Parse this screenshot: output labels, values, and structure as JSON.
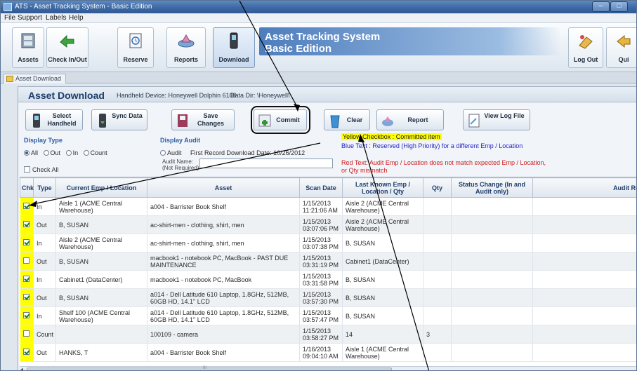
{
  "window": {
    "title": "ATS - Asset Tracking System - Basic Edition",
    "min": "–",
    "max": "□"
  },
  "menu": [
    "File",
    "Support",
    "Labels",
    "Help"
  ],
  "ribbon": {
    "buttons": [
      {
        "label": "Assets"
      },
      {
        "label": "Check In/Out"
      },
      {
        "label": "Reserve"
      },
      {
        "label": "Reports"
      },
      {
        "label": "Download"
      }
    ],
    "app_title_1": "Asset Tracking System",
    "app_title_2": "Basic Edition",
    "log_out": "Log Out",
    "quit": "Qui"
  },
  "doc_tab": "Asset Download",
  "panel": {
    "title": "Asset Download",
    "device": "Handheld Device:  Honeywell Dolphin 6100",
    "data_dir": "Data Dir: \\Honeywell\\"
  },
  "actions": {
    "select": "Select Handheld",
    "sync": "Sync Data",
    "save": "Save Changes",
    "commit": "Commit",
    "clear": "Clear",
    "report": "Report",
    "viewlog": "View Log File"
  },
  "display_type": {
    "label": "Display Type",
    "options": [
      "All",
      "Out",
      "In",
      "Count"
    ],
    "selected": "All"
  },
  "display_audit": {
    "label": "Display Audit",
    "audit_option": "Audit",
    "first_record": "First Record Download Date:   10/26/2012",
    "audit_name_label": "Audit Name:",
    "audit_name_hint": "(Not Required)",
    "audit_name_value": ""
  },
  "legend": {
    "yellow": "Yellow Checkbox :  Committed item",
    "blue": "Blue Text :  Reserved (High Priority) for a different Emp / Location",
    "red": "Red Text:  Audit Emp / Location does not match expected Emp / Location, or Qty mismatch"
  },
  "check_all": "Check All",
  "columns": [
    "Chk",
    "Type",
    "Current Emp / Location",
    "Asset",
    "Scan Date",
    "Last Known Emp / Location / Qty",
    "Qty",
    "Status Change (In and Audit only)",
    "Audit Result"
  ],
  "rows": [
    {
      "chk": true,
      "committed": true,
      "type": "In",
      "emp": "Aisle 1 (ACME Central Warehouse)",
      "asset": "a004 - Barrister Book Shelf",
      "scan": "1/15/2013 11:21:06 AM",
      "last": "Aisle 2 (ACME Central Warehouse)",
      "qty": "",
      "status": "",
      "result": "",
      "style": ""
    },
    {
      "chk": true,
      "committed": true,
      "type": "Out",
      "emp": "B, SUSAN",
      "asset": "ac-shirt-men - clothing, shirt, men",
      "scan": "1/15/2013 03:07:06 PM",
      "last": "Aisle 2 (ACME Central Warehouse)",
      "qty": "",
      "status": "",
      "result": "",
      "style": ""
    },
    {
      "chk": true,
      "committed": true,
      "type": "In",
      "emp": "Aisle 2 (ACME Central Warehouse)",
      "asset": "ac-shirt-men - clothing, shirt, men",
      "scan": "1/15/2013 03:07:38 PM",
      "last": "B, SUSAN",
      "qty": "",
      "status": "",
      "result": "",
      "style": ""
    },
    {
      "chk": false,
      "committed": true,
      "type": "Out",
      "emp": "B, SUSAN",
      "asset": "macbook1 - notebook PC, MacBook  -  PAST DUE MAINTENANCE",
      "scan": "1/15/2013 03:31:19 PM",
      "last": "Cabinet1 (DataCenter)",
      "qty": "",
      "status": "",
      "result": "",
      "style": "teal"
    },
    {
      "chk": true,
      "committed": true,
      "type": "In",
      "emp": "Cabinet1 (DataCenter)",
      "asset": "macbook1 - notebook PC, MacBook",
      "scan": "1/15/2013 03:31:58 PM",
      "last": "B, SUSAN",
      "qty": "",
      "status": "",
      "result": "",
      "style": ""
    },
    {
      "chk": true,
      "committed": true,
      "type": "Out",
      "emp": "B, SUSAN",
      "asset": "a014 - Dell Latitude 610 Laptop, 1.8GHz, 512MB, 60GB HD, 14.1\" LCD",
      "scan": "1/15/2013 03:57:30 PM",
      "last": "B, SUSAN",
      "qty": "",
      "status": "",
      "result": "",
      "style": ""
    },
    {
      "chk": true,
      "committed": true,
      "type": "In",
      "emp": "Shelf 100 (ACME Central Warehouse)",
      "asset": "a014 - Dell Latitude 610 Laptop, 1.8GHz, 512MB, 60GB HD, 14.1\" LCD",
      "scan": "1/15/2013 03:57:47 PM",
      "last": "B, SUSAN",
      "qty": "",
      "status": "",
      "result": "",
      "style": ""
    },
    {
      "chk": false,
      "committed": true,
      "type": "Count",
      "emp": "",
      "asset": "100109 - camera",
      "scan": "1/15/2013 03:58:27 PM",
      "last": "14",
      "qty": "3",
      "status": "",
      "result": "",
      "style": "redlast"
    },
    {
      "chk": true,
      "committed": true,
      "type": "Out",
      "emp": "HANKS, T",
      "asset": "a004 - Barrister Book Shelf",
      "scan": "1/16/2013 09:04:10 AM",
      "last": "Aisle 1 (ACME Central Warehouse)",
      "qty": "",
      "status": "",
      "result": "",
      "style": ""
    }
  ],
  "scrollbar_grip": "III"
}
